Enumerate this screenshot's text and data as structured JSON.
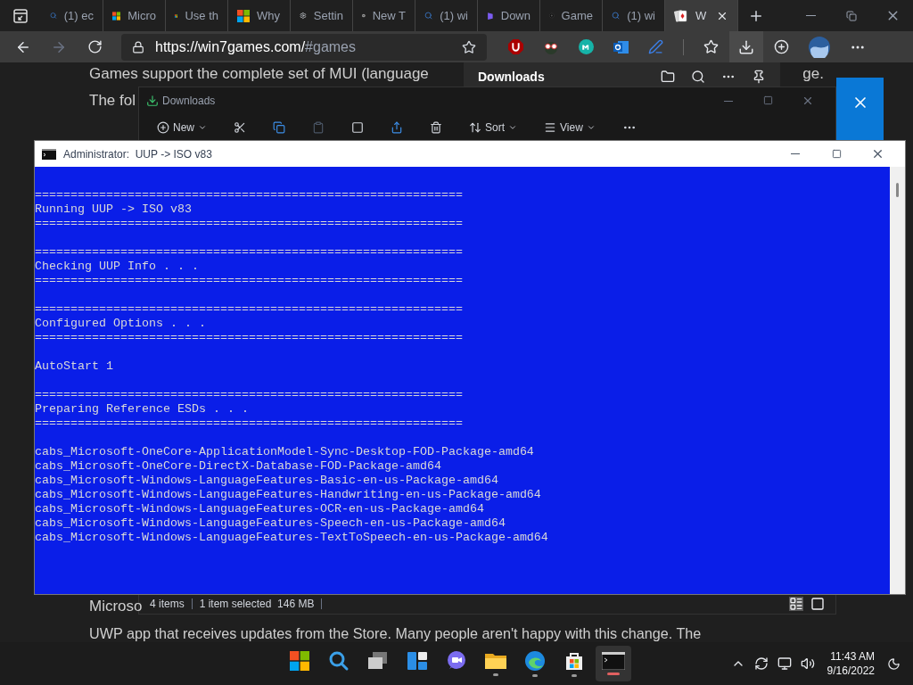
{
  "browser": {
    "tabs": [
      {
        "kind": "search",
        "title": "(1) ec",
        "selected": false
      },
      {
        "kind": "windows",
        "title": "Micro",
        "selected": false
      },
      {
        "kind": "windows",
        "title": "Use th",
        "selected": false
      },
      {
        "kind": "windows",
        "title": "Why",
        "selected": false
      },
      {
        "kind": "gear",
        "title": "Settin",
        "selected": false
      },
      {
        "kind": "m",
        "title": "New T",
        "selected": false
      },
      {
        "kind": "search",
        "title": "(1) wi",
        "selected": false
      },
      {
        "kind": "down",
        "title": "Down",
        "selected": false
      },
      {
        "kind": "game",
        "title": "Game",
        "selected": false
      },
      {
        "kind": "search",
        "title": "(1) wi",
        "selected": false
      },
      {
        "kind": "cards",
        "title": "W",
        "selected": true
      }
    ],
    "url_host": "https://win7games.com/",
    "url_rest": "#games"
  },
  "page": {
    "top_lines": [
      "Games support the complete set of MUI (language",
      "The fol"
    ],
    "top_line_end": "ge.",
    "bottom_lines": [
      "Microso",
      "UWP app that receives updates from the Store. Many people aren't happy with this change. The"
    ]
  },
  "downloads_flyout": {
    "title": "Downloads"
  },
  "explorer": {
    "title": "Downloads",
    "toolbar": {
      "new": "New",
      "sort": "Sort",
      "view": "View"
    },
    "status": [
      "4 items",
      "1 item selected  146 MB"
    ]
  },
  "console": {
    "title": "Administrator:  UUP -> ISO v83",
    "lines": [
      {
        "kind": "blank"
      },
      {
        "kind": "text",
        "text": "============================================================"
      },
      {
        "kind": "text",
        "text": "Running UUP -> ISO v83"
      },
      {
        "kind": "text",
        "text": "============================================================"
      },
      {
        "kind": "blank"
      },
      {
        "kind": "text",
        "text": "============================================================"
      },
      {
        "kind": "text",
        "text": "Checking UUP Info . . ."
      },
      {
        "kind": "text",
        "text": "============================================================"
      },
      {
        "kind": "blank"
      },
      {
        "kind": "text",
        "text": "============================================================"
      },
      {
        "kind": "text",
        "text": "Configured Options . . ."
      },
      {
        "kind": "text",
        "text": "============================================================"
      },
      {
        "kind": "blank"
      },
      {
        "kind": "text",
        "text": "AutoStart 1"
      },
      {
        "kind": "blank"
      },
      {
        "kind": "text",
        "text": "============================================================"
      },
      {
        "kind": "text",
        "text": "Preparing Reference ESDs . . ."
      },
      {
        "kind": "text",
        "text": "============================================================"
      },
      {
        "kind": "blank"
      },
      {
        "kind": "text",
        "text": "cabs_Microsoft-OneCore-ApplicationModel-Sync-Desktop-FOD-Package-amd64"
      },
      {
        "kind": "text",
        "text": "cabs_Microsoft-OneCore-DirectX-Database-FOD-Package-amd64"
      },
      {
        "kind": "text",
        "text": "cabs_Microsoft-Windows-LanguageFeatures-Basic-en-us-Package-amd64"
      },
      {
        "kind": "text",
        "text": "cabs_Microsoft-Windows-LanguageFeatures-Handwriting-en-us-Package-amd64"
      },
      {
        "kind": "text",
        "text": "cabs_Microsoft-Windows-LanguageFeatures-OCR-en-us-Package-amd64"
      },
      {
        "kind": "text",
        "text": "cabs_Microsoft-Windows-LanguageFeatures-Speech-en-us-Package-amd64"
      },
      {
        "kind": "text",
        "text": "cabs_Microsoft-Windows-LanguageFeatures-TextToSpeech-en-us-Package-amd64"
      }
    ]
  },
  "taskbar": {
    "apps": [
      {
        "kind": "start",
        "running": false
      },
      {
        "kind": "search",
        "running": false
      },
      {
        "kind": "taskview",
        "running": false
      },
      {
        "kind": "widgets",
        "running": false
      },
      {
        "kind": "chat",
        "running": false
      },
      {
        "kind": "explorer",
        "running": true
      },
      {
        "kind": "edge",
        "running": true
      },
      {
        "kind": "store",
        "running": true
      },
      {
        "kind": "terminal",
        "running": true
      }
    ],
    "time": "11:43 AM",
    "date": "9/16/2022"
  }
}
